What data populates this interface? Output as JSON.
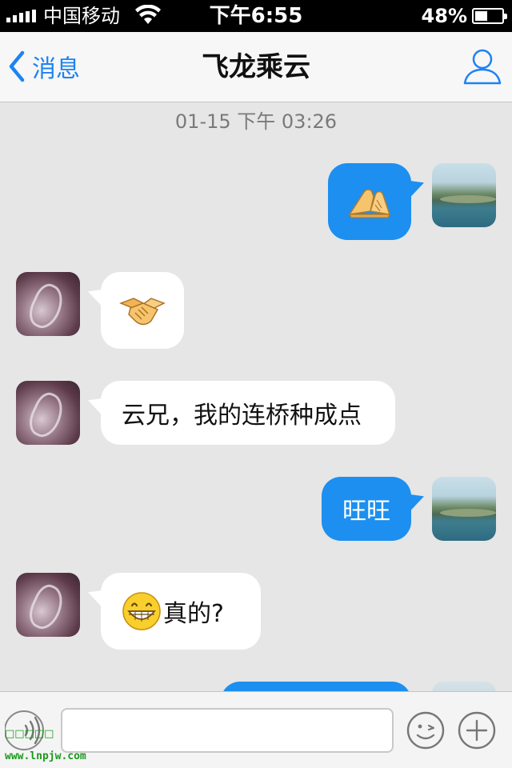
{
  "status_bar": {
    "carrier": "中国移动",
    "time": "下午6:55",
    "battery_percent": "48%",
    "battery_level": 0.48,
    "signal_icon": "signal-bars-icon",
    "wifi_icon": "wifi-icon",
    "battery_icon": "battery-icon"
  },
  "nav": {
    "back_label": "消息",
    "title": "飞龙乘云",
    "profile_icon": "person-icon"
  },
  "chat": {
    "timestamp": "01-15 下午 03:26",
    "messages": [
      {
        "direction": "outgoing",
        "type": "emoji",
        "emoji": "fist-palm-salute-icon"
      },
      {
        "direction": "incoming",
        "type": "emoji",
        "emoji": "handshake-icon"
      },
      {
        "direction": "incoming",
        "type": "text",
        "text": "云兄，我的连桥种成点"
      },
      {
        "direction": "outgoing",
        "type": "text",
        "text": "旺旺"
      },
      {
        "direction": "incoming",
        "type": "mixed",
        "emoji": "grin-face-icon",
        "text": "真的?"
      },
      {
        "direction": "outgoing",
        "type": "partial"
      }
    ]
  },
  "input_bar": {
    "voice_icon": "voice-icon",
    "text_value": "",
    "emoji_icon": "smiley-icon",
    "plus_icon": "plus-icon"
  },
  "watermark": {
    "line1": "□□□□□",
    "line2": "www.lnpjw.com"
  },
  "colors": {
    "accent": "#1c8ff0",
    "nav_tint": "#1d83f2",
    "chat_bg": "#e6e6e6",
    "incoming_bubble": "#ffffff",
    "outgoing_bubble": "#1c8ff0"
  }
}
